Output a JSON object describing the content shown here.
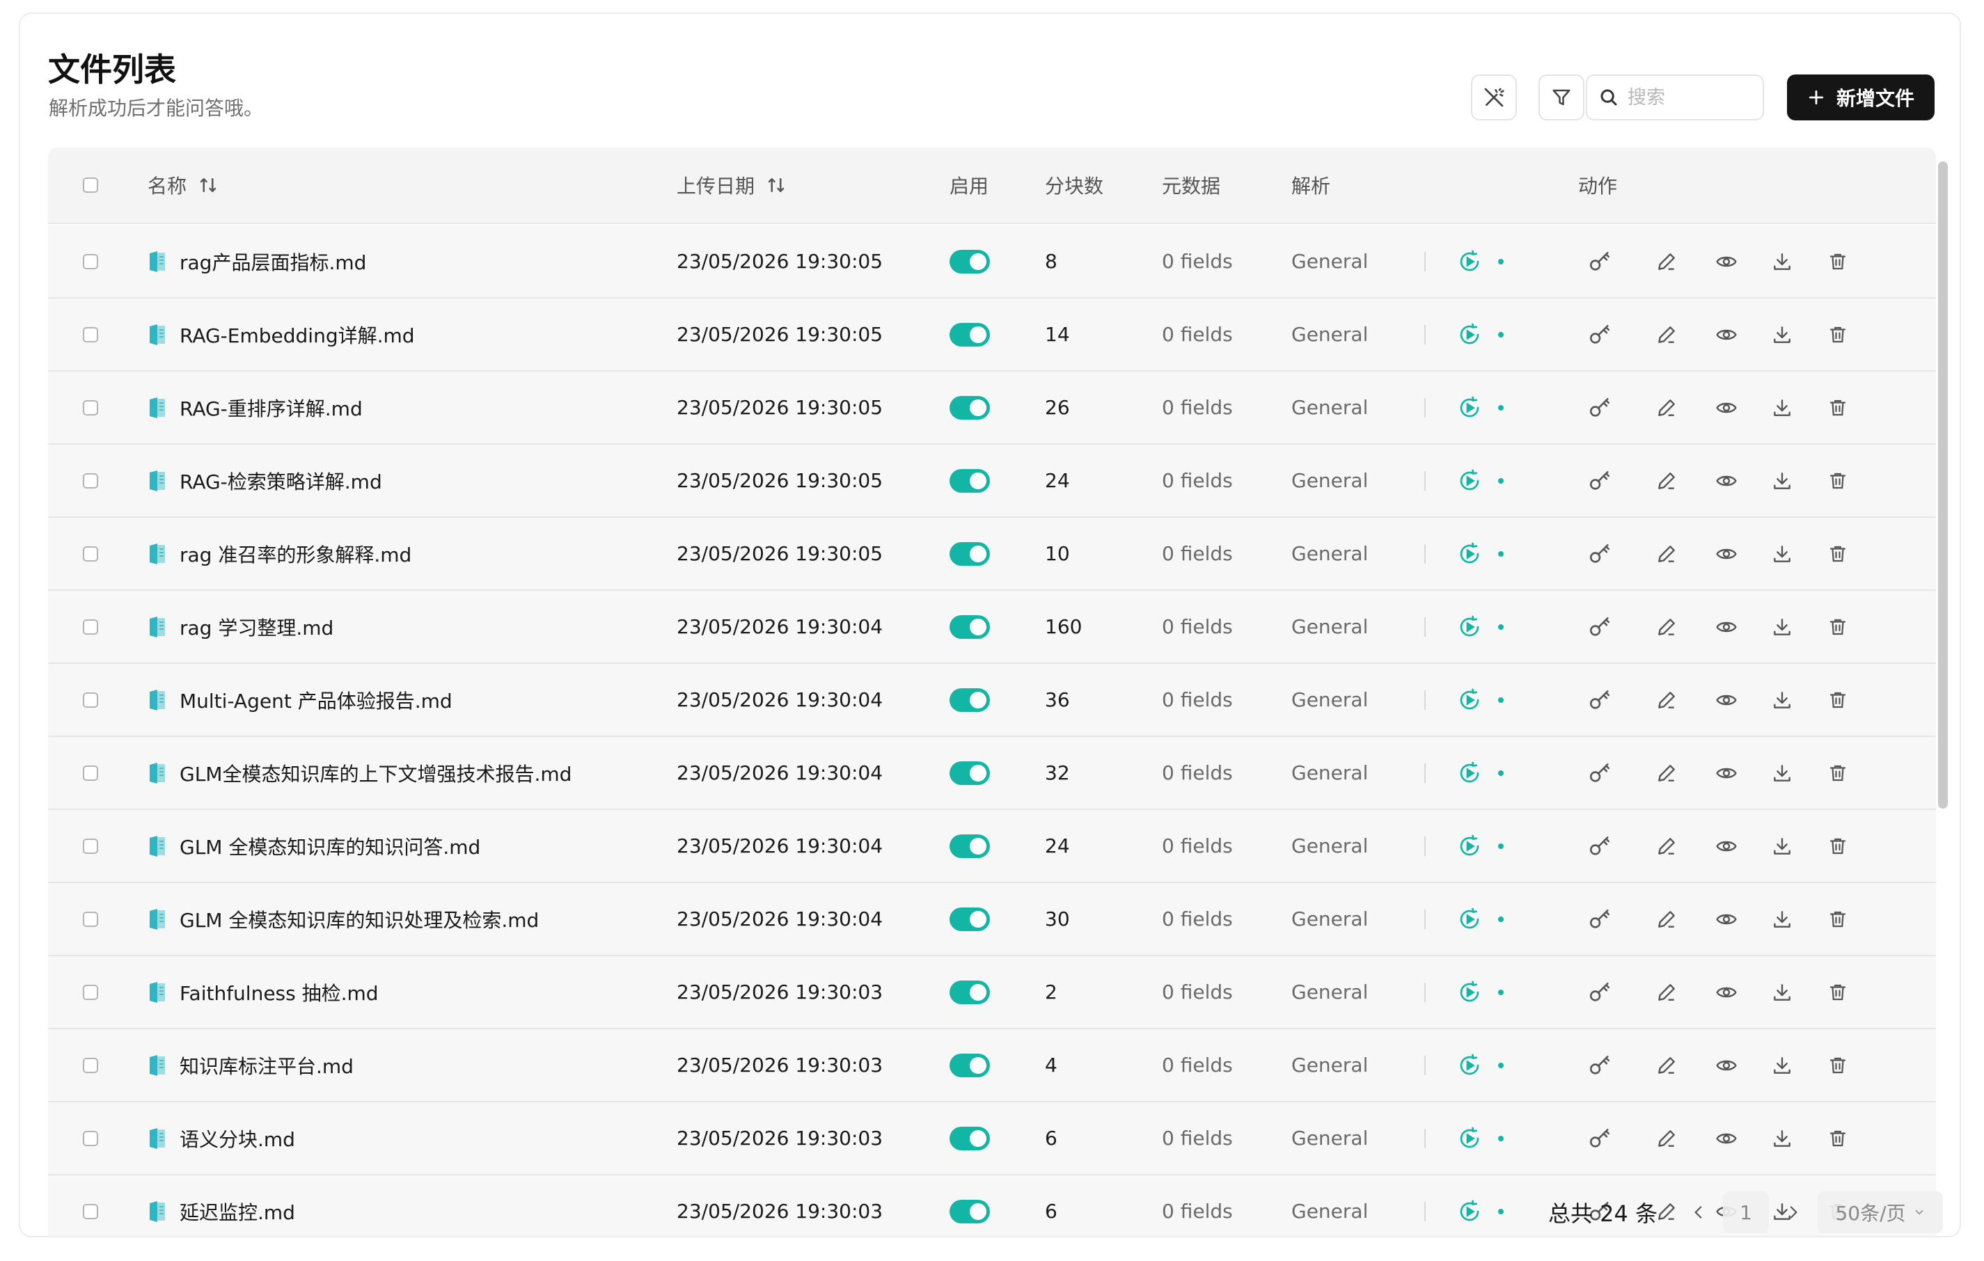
{
  "header": {
    "title": "文件列表",
    "subtitle": "解析成功后才能问答哦。"
  },
  "toolbar": {
    "search_placeholder": "搜索",
    "add_label": "新增文件",
    "icons": [
      "magic-wand-icon",
      "filter-icon",
      "search-icon",
      "plus-icon"
    ]
  },
  "table": {
    "columns": {
      "name": "名称",
      "date": "上传日期",
      "enabled": "启用",
      "chunks": "分块数",
      "metadata": "元数据",
      "parse": "解析",
      "actions": "动作"
    },
    "rows": [
      {
        "name": "rag产品层面指标.md",
        "date": "23/05/2026 19:30:05",
        "chunks": "8",
        "metadata": "0 fields",
        "parser": "General"
      },
      {
        "name": "RAG-Embedding详解.md",
        "date": "23/05/2026 19:30:05",
        "chunks": "14",
        "metadata": "0 fields",
        "parser": "General"
      },
      {
        "name": "RAG-重排序详解.md",
        "date": "23/05/2026 19:30:05",
        "chunks": "26",
        "metadata": "0 fields",
        "parser": "General"
      },
      {
        "name": "RAG-检索策略详解.md",
        "date": "23/05/2026 19:30:05",
        "chunks": "24",
        "metadata": "0 fields",
        "parser": "General"
      },
      {
        "name": "rag 准召率的形象解释.md",
        "date": "23/05/2026 19:30:05",
        "chunks": "10",
        "metadata": "0 fields",
        "parser": "General"
      },
      {
        "name": "rag 学习整理.md",
        "date": "23/05/2026 19:30:04",
        "chunks": "160",
        "metadata": "0 fields",
        "parser": "General"
      },
      {
        "name": "Multi-Agent 产品体验报告.md",
        "date": "23/05/2026 19:30:04",
        "chunks": "36",
        "metadata": "0 fields",
        "parser": "General"
      },
      {
        "name": "GLM全模态知识库的上下文增强技术报告.md",
        "date": "23/05/2026 19:30:04",
        "chunks": "32",
        "metadata": "0 fields",
        "parser": "General"
      },
      {
        "name": "GLM 全模态知识库的知识问答.md",
        "date": "23/05/2026 19:30:04",
        "chunks": "24",
        "metadata": "0 fields",
        "parser": "General"
      },
      {
        "name": "GLM 全模态知识库的知识处理及检索.md",
        "date": "23/05/2026 19:30:04",
        "chunks": "30",
        "metadata": "0 fields",
        "parser": "General"
      },
      {
        "name": "Faithfulness 抽检.md",
        "date": "23/05/2026 19:30:03",
        "chunks": "2",
        "metadata": "0 fields",
        "parser": "General"
      },
      {
        "name": "知识库标注平台.md",
        "date": "23/05/2026 19:30:03",
        "chunks": "4",
        "metadata": "0 fields",
        "parser": "General"
      },
      {
        "name": "语义分块.md",
        "date": "23/05/2026 19:30:03",
        "chunks": "6",
        "metadata": "0 fields",
        "parser": "General"
      },
      {
        "name": "延迟监控.md",
        "date": "23/05/2026 19:30:03",
        "chunks": "6",
        "metadata": "0 fields",
        "parser": "General"
      }
    ]
  },
  "pagination": {
    "total": "总共 24 条",
    "page": "1",
    "page_size": "50条/页"
  },
  "colors": {
    "accent": "#13b5a4",
    "primary_button": "#151515",
    "file_icon": "#2bb7c4"
  }
}
